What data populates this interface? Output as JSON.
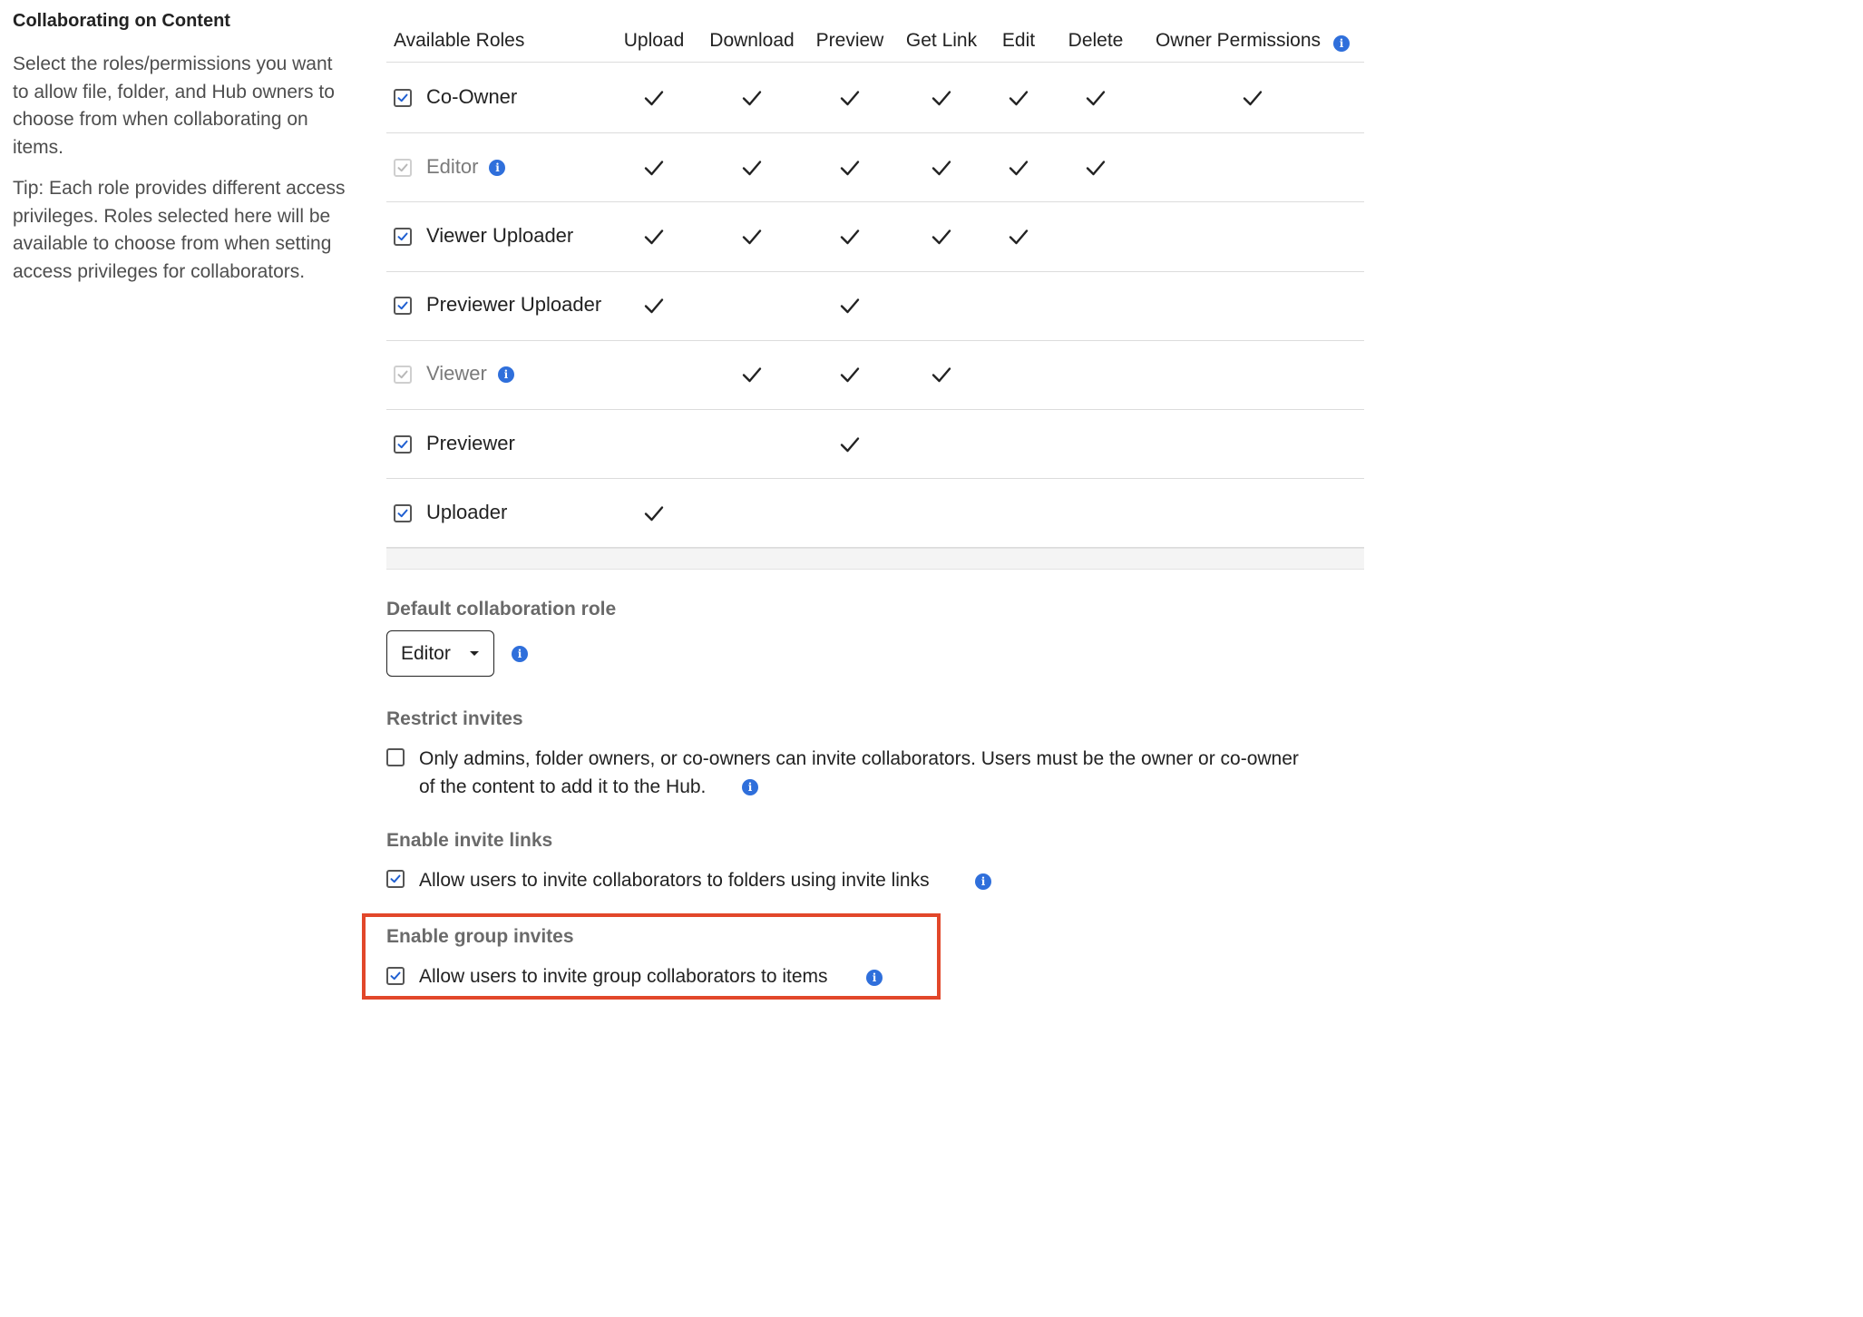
{
  "left_panel": {
    "title": "Collaborating on Content",
    "description": "Select the roles/permissions you want to allow file, folder, and Hub owners to choose from when collaborating on items.",
    "tip": "Tip: Each role provides different access privileges. Roles selected here will be available to choose from when setting access privileges for collaborators."
  },
  "roles_table": {
    "headers": {
      "roles": "Available Roles",
      "upload": "Upload",
      "download": "Download",
      "preview": "Preview",
      "get_link": "Get Link",
      "edit": "Edit",
      "delete": "Delete",
      "owner_permissions": "Owner Permissions"
    },
    "rows": [
      {
        "label": "Co-Owner",
        "checked": true,
        "disabled": false,
        "info": false,
        "perms": [
          true,
          true,
          true,
          true,
          true,
          true,
          true
        ]
      },
      {
        "label": "Editor",
        "checked": true,
        "disabled": true,
        "info": true,
        "perms": [
          true,
          true,
          true,
          true,
          true,
          true,
          false
        ]
      },
      {
        "label": "Viewer Uploader",
        "checked": true,
        "disabled": false,
        "info": false,
        "perms": [
          true,
          true,
          true,
          true,
          true,
          false,
          false
        ]
      },
      {
        "label": "Previewer Uploader",
        "checked": true,
        "disabled": false,
        "info": false,
        "perms": [
          true,
          false,
          true,
          false,
          false,
          false,
          false
        ]
      },
      {
        "label": "Viewer",
        "checked": true,
        "disabled": true,
        "info": true,
        "perms": [
          false,
          true,
          true,
          true,
          false,
          false,
          false
        ]
      },
      {
        "label": "Previewer",
        "checked": true,
        "disabled": false,
        "info": false,
        "perms": [
          false,
          false,
          true,
          false,
          false,
          false,
          false
        ]
      },
      {
        "label": "Uploader",
        "checked": true,
        "disabled": false,
        "info": false,
        "perms": [
          true,
          false,
          false,
          false,
          false,
          false,
          false
        ]
      }
    ]
  },
  "default_role": {
    "heading": "Default collaboration role",
    "selected": "Editor"
  },
  "restrict_invites": {
    "heading": "Restrict invites",
    "checked": false,
    "text_line1": "Only admins, folder owners, or co-owners can invite collaborators. Users must be the owner or co-owner",
    "text_line2": "of the content to add it to the Hub."
  },
  "invite_links": {
    "heading": "Enable invite links",
    "checked": true,
    "text": "Allow users to invite collaborators to folders using invite links"
  },
  "group_invites": {
    "heading": "Enable group invites",
    "checked": true,
    "text": "Allow users to invite group collaborators to items"
  },
  "colors": {
    "accent_blue": "#2f6fdb",
    "checkbox_check": "#1f5fd1",
    "highlight_red": "#e2472a"
  },
  "info_glyph": "i"
}
